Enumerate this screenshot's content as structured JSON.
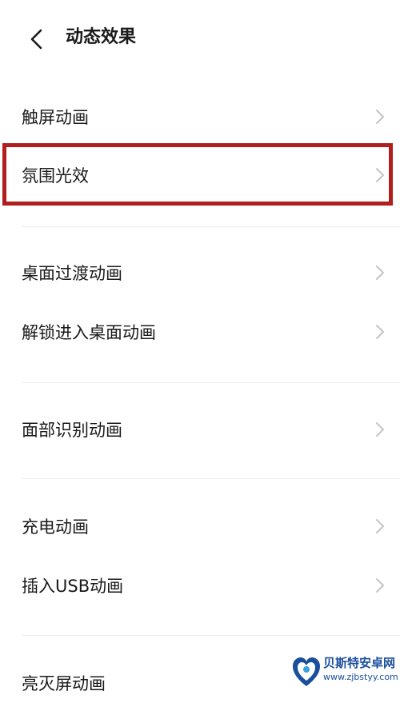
{
  "header": {
    "title": "动态效果"
  },
  "items": [
    {
      "label": "触屏动画"
    },
    {
      "label": "氛围光效"
    },
    {
      "label": "桌面过渡动画"
    },
    {
      "label": "解锁进入桌面动画"
    },
    {
      "label": "面部识别动画"
    },
    {
      "label": "充电动画"
    },
    {
      "label": "插入USB动画"
    },
    {
      "label": "亮灭屏动画"
    }
  ],
  "highlight": {
    "color": "#b01e1e",
    "target": "氛围光效"
  },
  "watermark": {
    "name": "贝斯特安卓网",
    "url": "www.zjbstyy.com",
    "color": "#1b4f9c"
  }
}
